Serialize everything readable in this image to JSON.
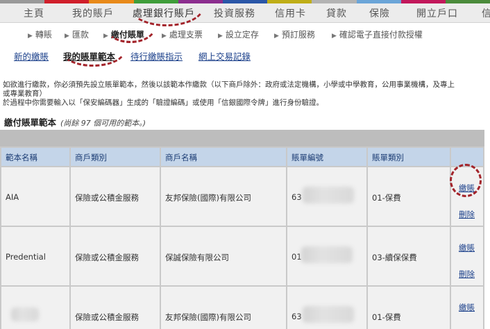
{
  "colors": {
    "strip": [
      "#999999",
      "#d01f2b",
      "#e88a1a",
      "#3f9d3a",
      "#8c2e8f",
      "#2b57a8",
      "#bfae17",
      "#b3b3b3",
      "#6ba5d8",
      "#c2185b",
      "#4b8b3b"
    ],
    "annotation": "#a3242b",
    "link": "#1a3f8a",
    "table_header_bg": "#c4d5e9"
  },
  "mainnav": {
    "items": [
      "主頁",
      "我的賬戶",
      "處理銀行賬戶",
      "投資服務",
      "信用卡",
      "貸款",
      "保險",
      "開立戶口",
      "信"
    ],
    "active": "處理銀行賬戶"
  },
  "subnav": {
    "items": [
      "轉賬",
      "匯款",
      "繳付賬單",
      "處理支票",
      "設立定存",
      "預訂服務",
      "確認電子直接付款授權"
    ],
    "active": "繳付賬單"
  },
  "tertiary": {
    "items": [
      "新的繳賬",
      "我的賬單範本",
      "待行繳賬指示",
      "網上交易記錄"
    ],
    "active": "我的賬單範本"
  },
  "instructions": {
    "line1": "如欲進行繳款，你必須預先設立賬單範本，然後以該範本作繳款（以下商戶除外：政府或法定機構，小學或中學教育，公用事業機構，及專上",
    "line2": "或專業教育）",
    "line3": "於過程中你需要輸入以「保安編碼器」生成的「驗證編碼」或使用「信銀國際令牌」進行身份驗證。"
  },
  "section": {
    "title": "繳付賬單範本",
    "note": "(尚餘 97 個可用的範本。)"
  },
  "table": {
    "headers": [
      "範本名稱",
      "商戶類別",
      "商戶名稱",
      "賬單編號",
      "賬單類別",
      ""
    ],
    "rows": [
      {
        "template": "AIA",
        "category": "保險或公積金服務",
        "merchant": "友邦保險(國際)有限公司",
        "bill_no_prefix": "63",
        "bill_type": "01-保費",
        "pay": "繳賬",
        "delete": "刪除"
      },
      {
        "template": "Predential",
        "category": "保險或公積金服務",
        "merchant": "保誠保險有限公司",
        "bill_no_prefix": "01",
        "bill_type": "03-續保保費",
        "pay": "繳賬",
        "delete": "刪除"
      },
      {
        "template": "",
        "category": "保險或公積金服務",
        "merchant": "友邦保險(國際)有限公司",
        "bill_no_prefix": "63",
        "bill_type": "01-保費",
        "pay": "繳賬",
        "delete": ""
      }
    ]
  }
}
